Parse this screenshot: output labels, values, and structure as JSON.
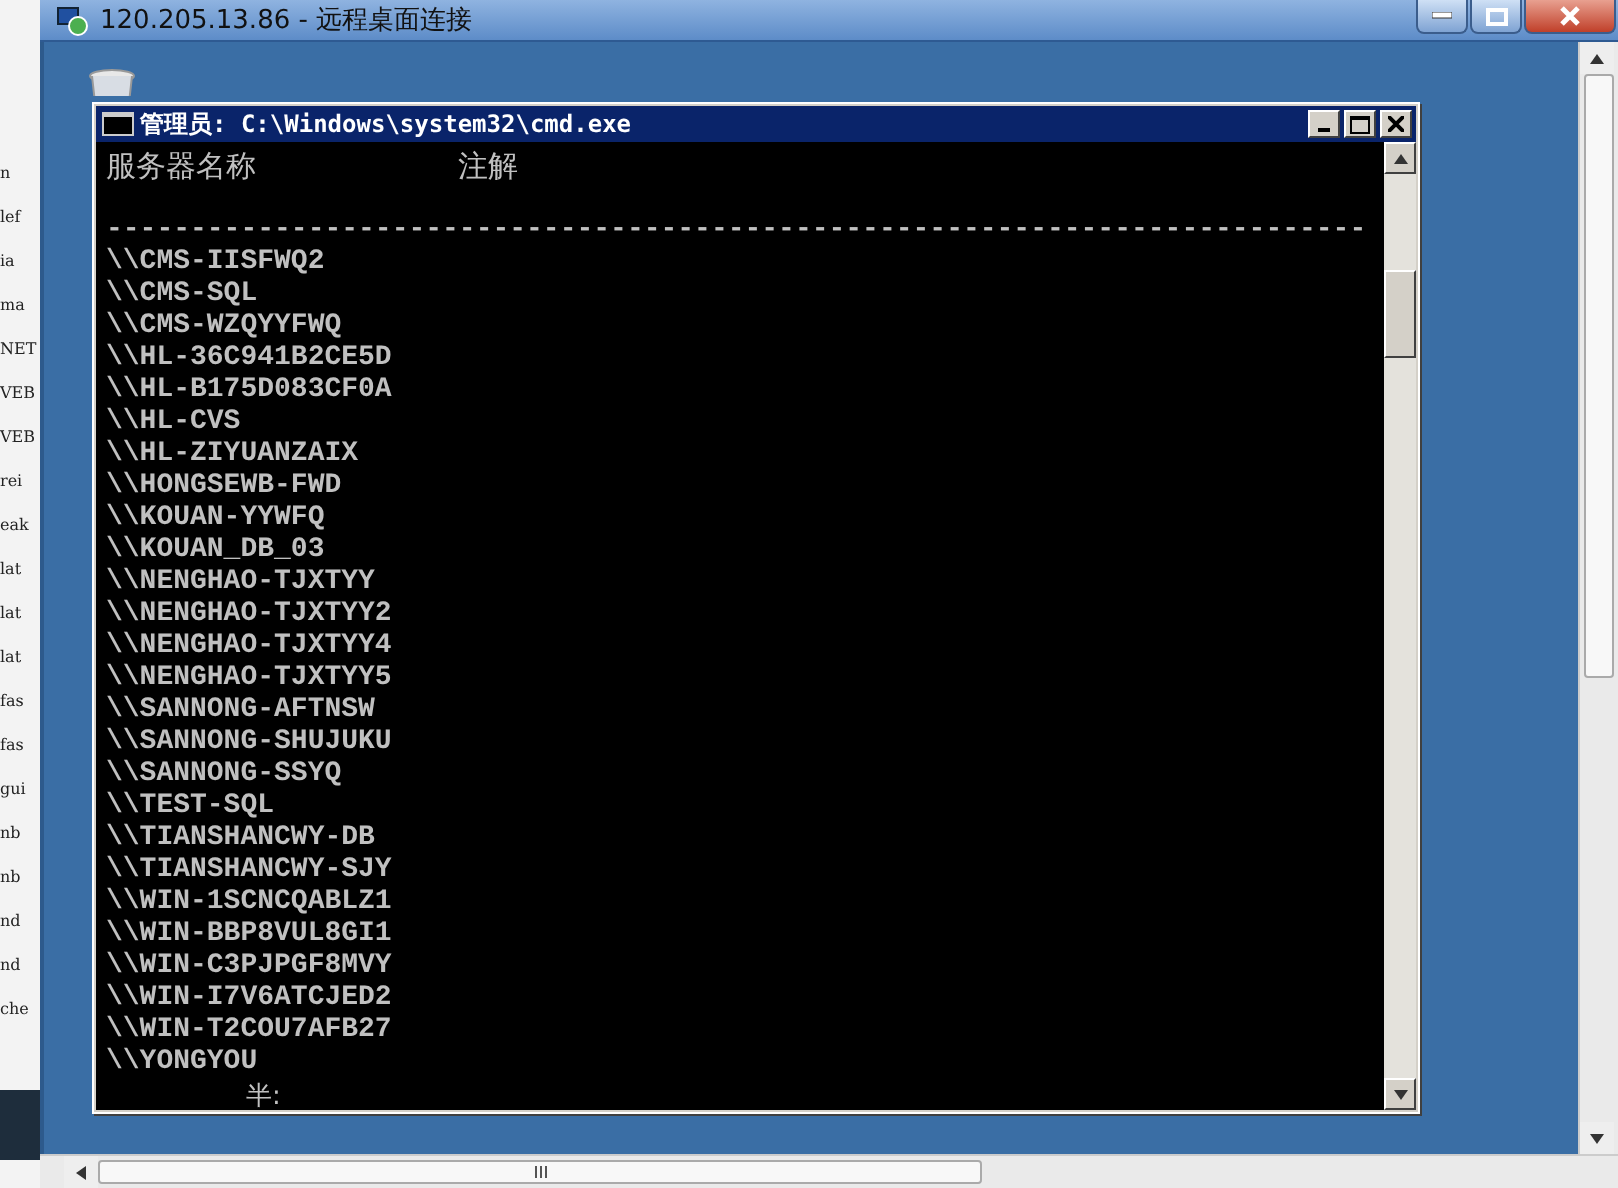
{
  "background_window": {
    "text_fragments": [
      "n",
      "lef",
      "ia",
      "ma",
      "NET",
      "VEB",
      "VEB",
      "rei",
      "eak",
      "lat",
      "lat",
      "lat",
      "fas",
      "fas",
      "gui",
      "nb",
      "nb",
      "nd",
      "nd",
      "che"
    ]
  },
  "remote_desktop_window": {
    "title": "120.205.13.86 - 远程桌面连接"
  },
  "console_window": {
    "title": "管理员: C:\\Windows\\system32\\cmd.exe",
    "header": {
      "column_1": "服务器名称",
      "column_2": "注解"
    },
    "separator": "---------------------------------------------------------------------------",
    "server_names": [
      "\\\\CMS-IISFWQ2",
      "\\\\CMS-SQL",
      "\\\\CMS-WZQYYFWQ",
      "\\\\HL-36C941B2CE5D",
      "\\\\HL-B175D083CF0A",
      "\\\\HL-CVS",
      "\\\\HL-ZIYUANZAIX",
      "\\\\HONGSEWB-FWD",
      "\\\\KOUAN-YYWFQ",
      "\\\\KOUAN_DB_03",
      "\\\\NENGHAO-TJXTYY",
      "\\\\NENGHAO-TJXTYY2",
      "\\\\NENGHAO-TJXTYY4",
      "\\\\NENGHAO-TJXTYY5",
      "\\\\SANNONG-AFTNSW",
      "\\\\SANNONG-SHUJUKU",
      "\\\\SANNONG-SSYQ",
      "\\\\TEST-SQL",
      "\\\\TIANSHANCWY-DB",
      "\\\\TIANSHANCWY-SJY",
      "\\\\WIN-1SCNCQABLZ1",
      "\\\\WIN-BBP8VUL8GI1",
      "\\\\WIN-C3PJPGF8MVY",
      "\\\\WIN-I7V6ATCJED2",
      "\\\\WIN-T2COU7AFB27",
      "\\\\YONGYOU"
    ],
    "last_line": "半:"
  }
}
